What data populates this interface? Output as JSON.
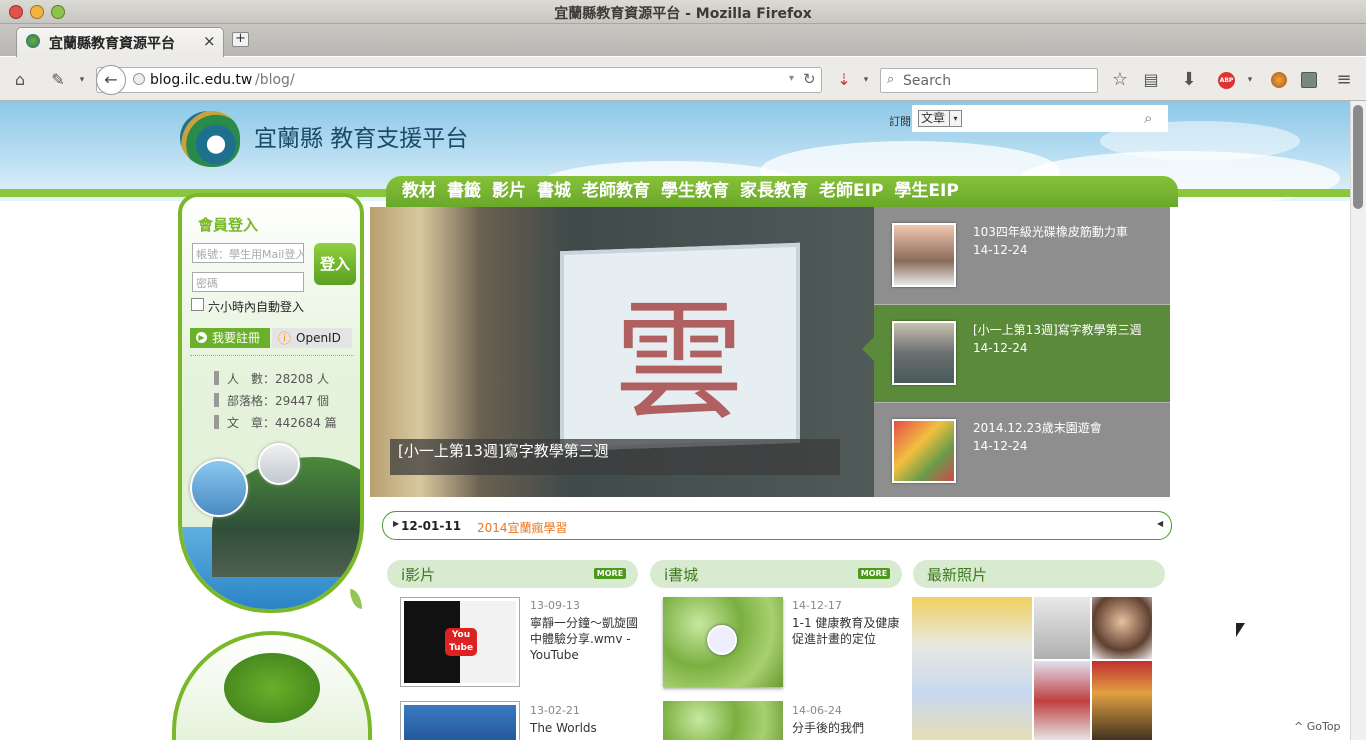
{
  "window": {
    "title": "宜蘭縣教育資源平台 - Mozilla Firefox"
  },
  "tab": {
    "label": "宜蘭縣教育資源平台",
    "close": "×",
    "new": "+"
  },
  "toolbar": {
    "url_host": "blog.ilc.edu.tw",
    "url_path": "/blog/",
    "search_placeholder": "Search"
  },
  "site": {
    "title": "宜蘭縣 教育支援平台",
    "subscribe_label": "訂閱",
    "subscribe_select": "文章",
    "nav": [
      "教材",
      "書籤",
      "影片",
      "書城",
      "老師教育",
      "學生教育",
      "家長教育",
      "老師EIP",
      "學生EIP"
    ]
  },
  "login": {
    "heading": "會員登入",
    "account_placeholder": "帳號：學生用Mail登入",
    "password_placeholder": "密碼",
    "login_button": "登入",
    "remember_label": "六小時內自動登入",
    "register_button": "我要註冊",
    "openid_button": "OpenID"
  },
  "stats": [
    {
      "label": "人　數：",
      "value": "28208 人"
    },
    {
      "label": "部落格：",
      "value": "29447 個"
    },
    {
      "label": "文　章：",
      "value": "442684 篇"
    }
  ],
  "slider": {
    "caption": "[小一上第13週]寫字教學第三週",
    "items": [
      {
        "title": "103四年級光碟橡皮筋動力車",
        "date": "14-12-24"
      },
      {
        "title": "[小一上第13週]寫字教學第三週",
        "date": "14-12-24"
      },
      {
        "title": "2014.12.23歲末園遊會",
        "date": "14-12-24"
      }
    ]
  },
  "ticker": {
    "date": "12-01-11",
    "text": "2014宜蘭瘋學習"
  },
  "sections": {
    "video": {
      "title": "i影片",
      "more": "MORE",
      "items": [
        {
          "date": "13-09-13",
          "text": "寧靜一分鐘～凱旋國中體驗分享.wmv - YouTube"
        },
        {
          "date": "13-02-21",
          "text": "The Worlds"
        }
      ]
    },
    "books": {
      "title": "i書城",
      "more": "MORE",
      "items": [
        {
          "date": "14-12-17",
          "text": "1-1 健康教育及健康促進計畫的定位"
        },
        {
          "date": "14-06-24",
          "text": "分手後的我們"
        }
      ]
    },
    "photos": {
      "title": "最新照片"
    }
  },
  "gotop": "^ GoTop",
  "colors": {
    "nav_green": "#7ab82a",
    "active_green": "#5b8a3a",
    "ticker_orange": "#e87722"
  }
}
